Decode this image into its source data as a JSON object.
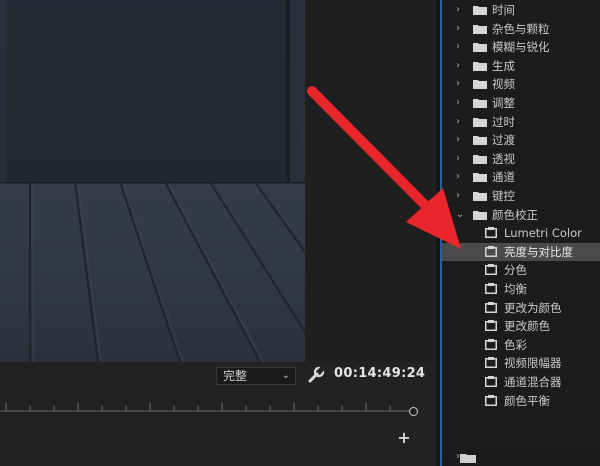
{
  "monitor": {
    "quality_select": "完整",
    "timecode": "00:14:49:24"
  },
  "effects_panel": {
    "folders": [
      {
        "label": "时间",
        "expanded": false
      },
      {
        "label": "杂色与颗粒",
        "expanded": false
      },
      {
        "label": "模糊与锐化",
        "expanded": false
      },
      {
        "label": "生成",
        "expanded": false
      },
      {
        "label": "视频",
        "expanded": false
      },
      {
        "label": "调整",
        "expanded": false
      },
      {
        "label": "过时",
        "expanded": false
      },
      {
        "label": "过渡",
        "expanded": false
      },
      {
        "label": "透视",
        "expanded": false
      },
      {
        "label": "通道",
        "expanded": false
      },
      {
        "label": "键控",
        "expanded": false
      },
      {
        "label": "颜色校正",
        "expanded": true
      }
    ],
    "color_correction_items": [
      {
        "label": "Lumetri Color"
      },
      {
        "label": "亮度与对比度",
        "selected": true
      },
      {
        "label": "分色"
      },
      {
        "label": "均衡"
      },
      {
        "label": "更改为颜色"
      },
      {
        "label": "更改颜色"
      },
      {
        "label": "色彩"
      },
      {
        "label": "视频限幅器"
      },
      {
        "label": "通道混合器"
      },
      {
        "label": "颜色平衡"
      }
    ]
  },
  "colors": {
    "annotation_arrow": "#e8262b",
    "panel_focus_border": "#2a5ea8",
    "selection_bg": "#4b4b4b"
  }
}
